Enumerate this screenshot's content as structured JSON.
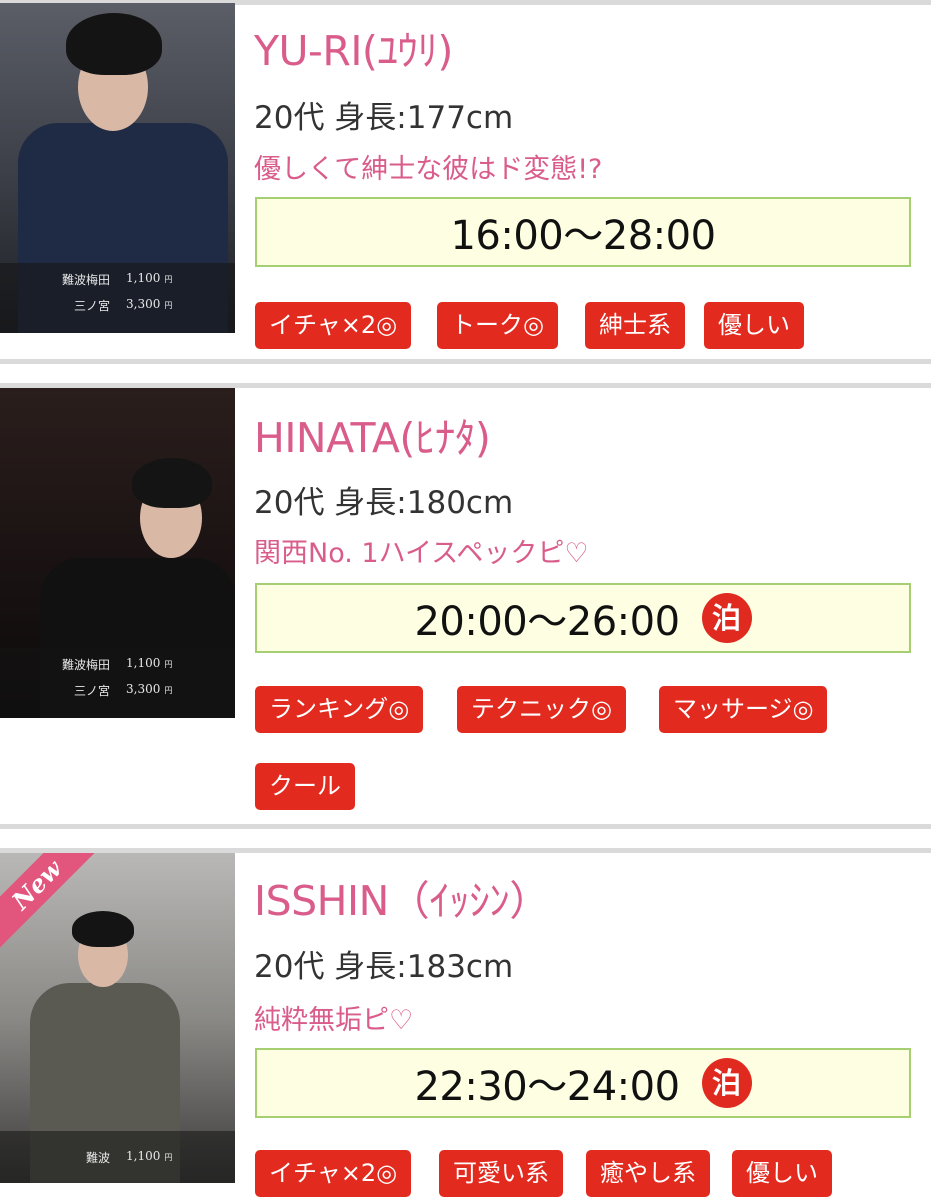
{
  "casts": [
    {
      "name": "YU-RI(ﾕｳﾘ)",
      "meta": "20代 身長:177cm",
      "catchcopy": "優しくて紳士な彼はド変態!?",
      "hours": "16:00〜28:00",
      "stay_badge": "",
      "prices": [
        {
          "area": "難波梅田",
          "amount": "1,100",
          "unit": "円"
        },
        {
          "area": "三ノ宮",
          "amount": "3,300",
          "unit": "円"
        }
      ],
      "tags": [
        "イチャ×2◎",
        "トーク◎",
        "紳士系",
        "優しい"
      ]
    },
    {
      "name": "HINATA(ﾋﾅﾀ)",
      "meta": "20代 身長:180cm",
      "catchcopy": "関西No. 1ハイスペックピ♡",
      "hours": "20:00〜26:00",
      "stay_badge": "泊",
      "prices": [
        {
          "area": "難波梅田",
          "amount": "1,100",
          "unit": "円"
        },
        {
          "area": "三ノ宮",
          "amount": "3,300",
          "unit": "円"
        }
      ],
      "tags": [
        "ランキング◎",
        "テクニック◎",
        "マッサージ◎",
        "クール"
      ]
    },
    {
      "name": "ISSHIN（ｲｯｼﾝ）",
      "meta": "20代 身長:183cm",
      "catchcopy": "純粋無垢ピ♡",
      "hours": "22:30〜24:00",
      "stay_badge": "泊",
      "new_label": "New",
      "prices": [
        {
          "area": "難波",
          "amount": "1,100",
          "unit": "円"
        }
      ],
      "tags": [
        "イチャ×2◎",
        "可愛い系",
        "癒やし系",
        "優しい"
      ]
    }
  ]
}
